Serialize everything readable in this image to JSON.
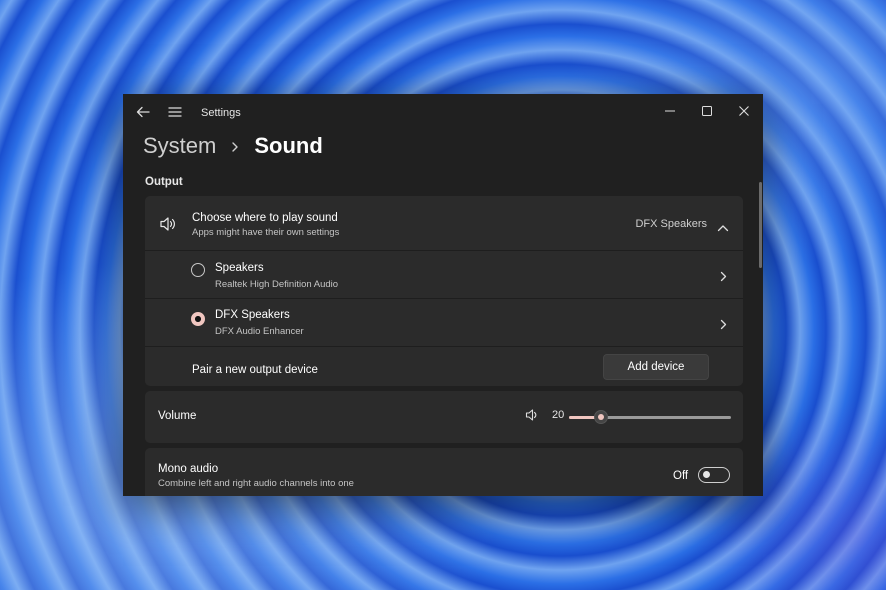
{
  "window": {
    "title": "Settings"
  },
  "breadcrumb": {
    "parent": "System",
    "current": "Sound"
  },
  "output": {
    "section_label": "Output",
    "choose": {
      "title": "Choose where to play sound",
      "subtitle": "Apps might have their own settings",
      "selected_value": "DFX Speakers",
      "expanded": true
    },
    "devices": [
      {
        "name": "Speakers",
        "description": "Realtek High Definition Audio",
        "selected": false
      },
      {
        "name": "DFX Speakers",
        "description": "DFX Audio Enhancer",
        "selected": true
      }
    ],
    "pair": {
      "label": "Pair a new output device",
      "button_label": "Add device"
    }
  },
  "volume": {
    "label": "Volume",
    "value": 20,
    "value_text": "20"
  },
  "mono_audio": {
    "title": "Mono audio",
    "subtitle": "Combine left and right audio channels into one",
    "state_text": "Off",
    "enabled": false
  },
  "colors": {
    "accent": "#f0c6c0",
    "window_bg": "#202020",
    "card_bg": "#2b2b2b"
  },
  "icons": {
    "back": "back-arrow-icon",
    "menu": "hamburger-menu-icon",
    "speaker": "speaker-icon",
    "volume": "volume-icon",
    "chevron_up": "chevron-up-icon",
    "chevron_right": "chevron-right-icon"
  }
}
